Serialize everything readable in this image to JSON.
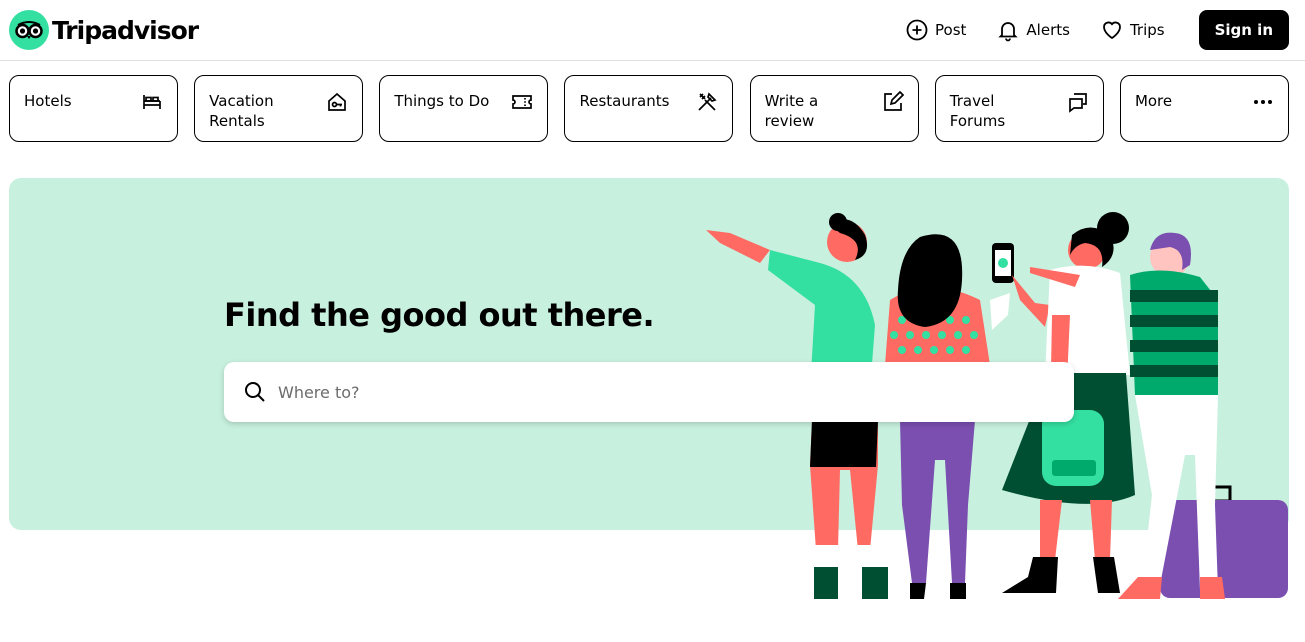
{
  "brand": {
    "name": "Tripadvisor",
    "accent_color": "#34e0a1"
  },
  "header": {
    "nav": [
      {
        "label": "Post",
        "icon": "plus-circle-icon"
      },
      {
        "label": "Alerts",
        "icon": "bell-icon"
      },
      {
        "label": "Trips",
        "icon": "heart-icon"
      }
    ],
    "sign_in_label": "Sign in"
  },
  "categories": [
    {
      "label": "Hotels",
      "icon": "bed-icon"
    },
    {
      "label": "Vacation Rentals",
      "icon": "house-key-icon"
    },
    {
      "label": "Things to Do",
      "icon": "ticket-icon"
    },
    {
      "label": "Restaurants",
      "icon": "utensils-icon"
    },
    {
      "label": "Write a review",
      "icon": "pencil-square-icon"
    },
    {
      "label": "Travel Forums",
      "icon": "chat-bubbles-icon"
    },
    {
      "label": "More",
      "icon": "ellipsis-icon"
    }
  ],
  "hero": {
    "headline": "Find the good out there.",
    "search_placeholder": "Where to?",
    "background_color": "#c8f0df"
  }
}
